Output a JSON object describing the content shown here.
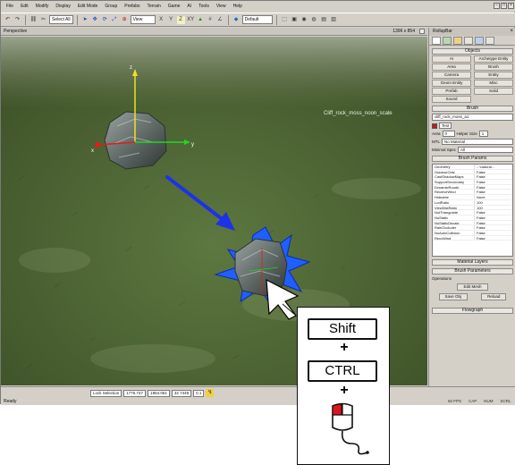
{
  "menu": [
    "File",
    "Edit",
    "Modify",
    "Display",
    "Edit Mode",
    "Group",
    "Prefabs",
    "Terrain",
    "Game",
    "AI",
    "Tools",
    "View",
    "Help"
  ],
  "toolbar": {
    "selection_set": "Select All",
    "ref_coord": "View",
    "axis_x": "X",
    "axis_y": "Y",
    "axis_z": "Z",
    "axis_xy": "XY",
    "layer": "Default"
  },
  "viewport": {
    "label": "Perspective",
    "resolution": "1396 x 854",
    "annotation": "Cliff_rock_moss_noon_scale"
  },
  "rollup": {
    "title": "RollupBar",
    "objects_header": "Objects",
    "object_buttons": [
      "AI",
      "Archetype Entity",
      "Area",
      "Brush",
      "Camera",
      "Entity",
      "Geom Entity",
      "Misc",
      "Prefab",
      "Solid",
      "Sound"
    ],
    "brush_header": "Brush",
    "brush_name": "cliff_rock_moss_a1",
    "brush_label": "Test",
    "area_label": "Area",
    "area_value": "0",
    "helper_size_label": "Helper Size",
    "helper_size_value": "1",
    "mtl_label": "MTL",
    "mtl_value": "No Material",
    "minspec_label": "Minimal Spec",
    "minspec_value": "All",
    "params_header": "Brush Params",
    "properties": [
      {
        "name": "Geometry",
        "value": "...\\natural..."
      },
      {
        "name": "OutdoorOnly",
        "value": "False"
      },
      {
        "name": "CastShadowMaps",
        "value": "False"
      },
      {
        "name": "SupportSecondary",
        "value": "False"
      },
      {
        "name": "DynamicRough",
        "value": "False"
      },
      {
        "name": "ReceiveWind",
        "value": "False"
      },
      {
        "name": "Hideable",
        "value": "None"
      },
      {
        "name": "LodRatio",
        "value": "100"
      },
      {
        "name": "ViewDistRatio",
        "value": "100"
      },
      {
        "name": "NotTriangulate",
        "value": "False"
      },
      {
        "name": "NoStatic",
        "value": "False"
      },
      {
        "name": "NoStaticDecals",
        "value": "False"
      },
      {
        "name": "RainOccluder",
        "value": "False"
      },
      {
        "name": "NoAutoCollision",
        "value": "False"
      },
      {
        "name": "RecvWind",
        "value": "False"
      }
    ],
    "material_layers_header": "Material Layers",
    "brush_params_header": "Brush Parameters",
    "operations_label": "Operations",
    "reload_button": "Edit Mesh",
    "save_button": "Save Obj",
    "reload2_button": "Reload",
    "flowgraph_header": "Flowgraph"
  },
  "status": {
    "ready": "Ready",
    "lock_selection": "Lock Selection",
    "x": "1776.747",
    "y": "1954.061",
    "z": "32.7449",
    "speed": "0.1",
    "fps": "60 FPS",
    "mem": "CAP",
    "num": "NUM",
    "scrl": "SCRL"
  },
  "callout": {
    "key1": "Shift",
    "plus1": "+",
    "key2": "CTRL",
    "plus2": "+"
  },
  "colors": {
    "arrow": "#1b33e8",
    "gizmo_x": "#e01d1d",
    "gizmo_y": "#f0e020",
    "gizmo_z": "#1ed81e",
    "highlight": "#1f5fff",
    "mouse_button": "#e0141e"
  }
}
